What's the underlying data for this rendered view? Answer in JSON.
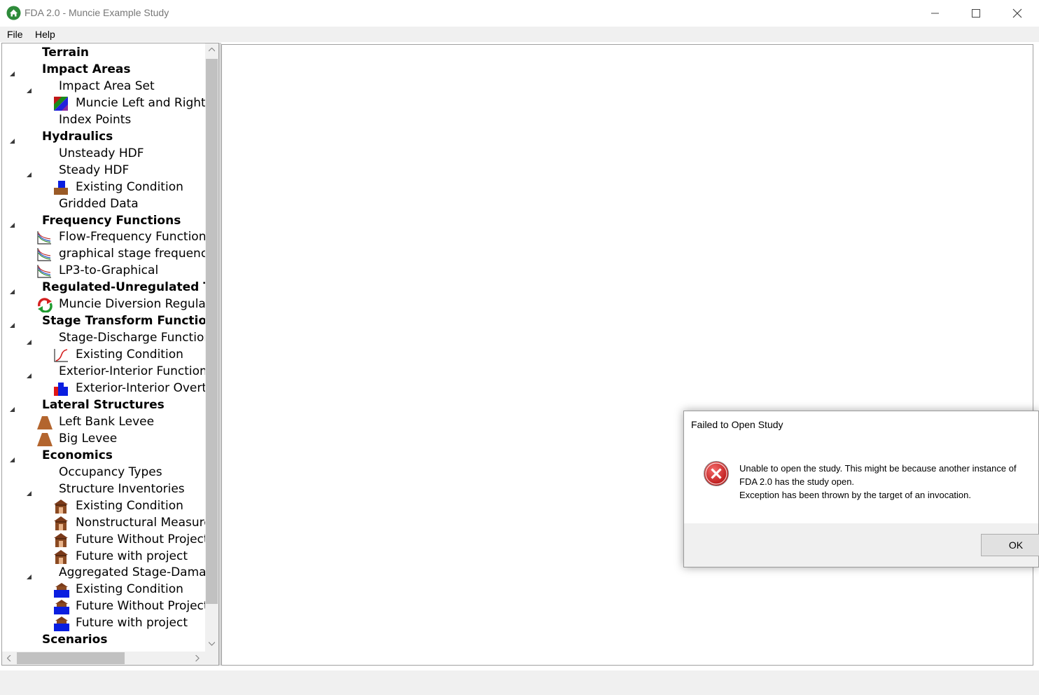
{
  "window": {
    "title": "FDA 2.0 - Muncie Example Study"
  },
  "menu": {
    "file": "File",
    "help": "Help"
  },
  "tree": [
    {
      "label": "Terrain",
      "bold": true,
      "level": 0,
      "arrow": false,
      "icon": ""
    },
    {
      "label": "Impact Areas",
      "bold": true,
      "level": 0,
      "arrow": true,
      "icon": ""
    },
    {
      "label": "Impact Area Set",
      "bold": false,
      "level": 1,
      "arrow": true,
      "icon": ""
    },
    {
      "label": "Muncie Left and Right B",
      "bold": false,
      "level": 2,
      "arrow": false,
      "icon": "impact-area-icon"
    },
    {
      "label": "Index Points",
      "bold": false,
      "level": 1,
      "arrow": false,
      "icon": ""
    },
    {
      "label": "Hydraulics",
      "bold": true,
      "level": 0,
      "arrow": true,
      "icon": ""
    },
    {
      "label": "Unsteady HDF",
      "bold": false,
      "level": 1,
      "arrow": false,
      "icon": ""
    },
    {
      "label": "Steady HDF",
      "bold": false,
      "level": 1,
      "arrow": true,
      "icon": ""
    },
    {
      "label": "Existing Condition",
      "bold": false,
      "level": 2,
      "arrow": false,
      "icon": "water-surface-icon"
    },
    {
      "label": "Gridded Data",
      "bold": false,
      "level": 1,
      "arrow": false,
      "icon": ""
    },
    {
      "label": "Frequency Functions",
      "bold": true,
      "level": 0,
      "arrow": true,
      "icon": ""
    },
    {
      "label": "Flow-Frequency Function",
      "bold": false,
      "level": 1,
      "arrow": false,
      "icon": "frequency-curve-icon"
    },
    {
      "label": "graphical stage frequency",
      "bold": false,
      "level": 1,
      "arrow": false,
      "icon": "frequency-curve-icon"
    },
    {
      "label": "LP3-to-Graphical",
      "bold": false,
      "level": 1,
      "arrow": false,
      "icon": "frequency-curve-icon"
    },
    {
      "label": "Regulated-Unregulated Trar",
      "bold": true,
      "level": 0,
      "arrow": true,
      "icon": ""
    },
    {
      "label": "Muncie Diversion Regulate",
      "bold": false,
      "level": 1,
      "arrow": false,
      "icon": "regulated-transform-icon"
    },
    {
      "label": "Stage Transform Functions",
      "bold": true,
      "level": 0,
      "arrow": true,
      "icon": ""
    },
    {
      "label": "Stage-Discharge Functions",
      "bold": false,
      "level": 1,
      "arrow": true,
      "icon": ""
    },
    {
      "label": "Existing Condition",
      "bold": false,
      "level": 2,
      "arrow": false,
      "icon": "rating-curve-icon"
    },
    {
      "label": "Exterior-Interior Functions",
      "bold": false,
      "level": 1,
      "arrow": true,
      "icon": ""
    },
    {
      "label": "Exterior-Interior Overtop",
      "bold": false,
      "level": 2,
      "arrow": false,
      "icon": "exterior-interior-icon"
    },
    {
      "label": "Lateral Structures",
      "bold": true,
      "level": 0,
      "arrow": true,
      "icon": ""
    },
    {
      "label": "Left Bank Levee",
      "bold": false,
      "level": 1,
      "arrow": false,
      "icon": "levee-icon"
    },
    {
      "label": "Big Levee",
      "bold": false,
      "level": 1,
      "arrow": false,
      "icon": "levee-icon"
    },
    {
      "label": "Economics",
      "bold": true,
      "level": 0,
      "arrow": true,
      "icon": ""
    },
    {
      "label": "Occupancy Types",
      "bold": false,
      "level": 1,
      "arrow": false,
      "icon": ""
    },
    {
      "label": "Structure Inventories",
      "bold": false,
      "level": 1,
      "arrow": true,
      "icon": ""
    },
    {
      "label": "Existing Condition",
      "bold": false,
      "level": 2,
      "arrow": false,
      "icon": "structure-icon"
    },
    {
      "label": "Nonstructural Measures",
      "bold": false,
      "level": 2,
      "arrow": false,
      "icon": "structure-icon"
    },
    {
      "label": "Future Without Project",
      "bold": false,
      "level": 2,
      "arrow": false,
      "icon": "structure-icon"
    },
    {
      "label": "Future with project",
      "bold": false,
      "level": 2,
      "arrow": false,
      "icon": "structure-icon"
    },
    {
      "label": "Aggregated Stage-Damage",
      "bold": false,
      "level": 1,
      "arrow": true,
      "icon": ""
    },
    {
      "label": "Existing Condition",
      "bold": false,
      "level": 2,
      "arrow": false,
      "icon": "stage-damage-icon"
    },
    {
      "label": "Future Without Project",
      "bold": false,
      "level": 2,
      "arrow": false,
      "icon": "stage-damage-icon"
    },
    {
      "label": "Future with project",
      "bold": false,
      "level": 2,
      "arrow": false,
      "icon": "stage-damage-icon"
    },
    {
      "label": "Scenarios",
      "bold": true,
      "level": 0,
      "arrow": false,
      "icon": ""
    }
  ],
  "dialog": {
    "title": "Failed to Open Study",
    "message_line1": "Unable to open the study. This might be because another instance of",
    "message_line2": "FDA 2.0 has the study open.",
    "message_line3": "Exception has been thrown by the target of an invocation.",
    "ok_label": "OK",
    "icon": "error-icon"
  }
}
